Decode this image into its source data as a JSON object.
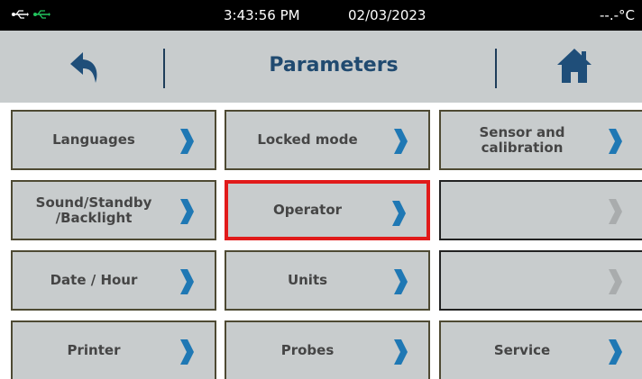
{
  "status_bar": {
    "time": "3:43:56 PM",
    "date": "02/03/2023",
    "temperature": "--.-°C",
    "icons": [
      "usb-icon-white",
      "usb-icon-green"
    ],
    "usb_active_color": "#22c55e"
  },
  "header": {
    "title": "Parameters",
    "back_icon": "back-arrow-icon",
    "home_icon": "home-icon"
  },
  "colors": {
    "tile_bg": "#c8cccd",
    "tile_border": "#4e4a33",
    "chevron_active": "#1f78b4",
    "chevron_disabled": "#a9acad",
    "selection_border": "#e11a1a",
    "title": "#204a70"
  },
  "menu": {
    "languages": "Languages",
    "locked_mode": "Locked mode",
    "sensor_calibration": "Sensor and calibration",
    "sound_standby_backlight": "Sound/Standby /Backlight",
    "operator": "Operator",
    "empty_1": "",
    "date_hour": "Date / Hour",
    "units": "Units",
    "empty_2": "",
    "printer": "Printer",
    "probes": "Probes",
    "service": "Service"
  },
  "selected_item": "Operator"
}
